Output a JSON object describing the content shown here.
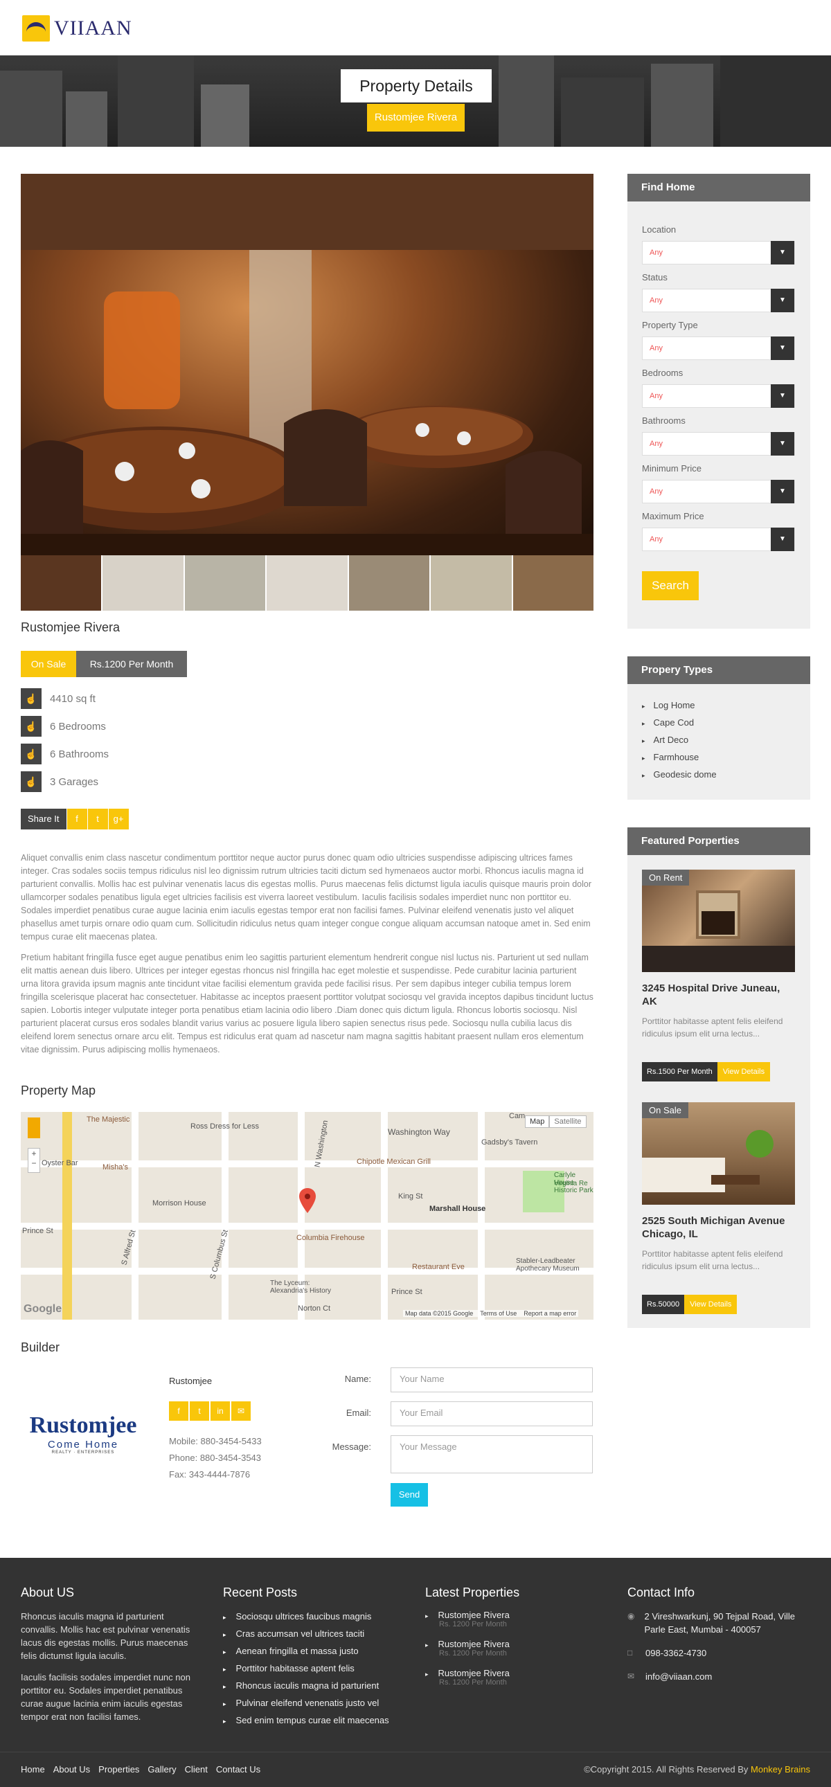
{
  "brand": {
    "name": "VIIAAN",
    "logo_icon": "viiaan-logo-mark"
  },
  "banner": {
    "title": "Property Details",
    "subtitle": "Rustomjee Rivera"
  },
  "property": {
    "name": "Rustomjee Rivera",
    "status": "On Sale",
    "price": "Rs.1200 Per Month",
    "features": [
      {
        "icon": "thumbs-up-icon",
        "text": "4410 sq ft"
      },
      {
        "icon": "thumbs-up-icon",
        "text": "6 Bedrooms"
      },
      {
        "icon": "thumbs-up-icon",
        "text": "6 Bathrooms"
      },
      {
        "icon": "thumbs-up-icon",
        "text": "3 Garages"
      }
    ],
    "share_label": "Share It",
    "share_icons": [
      "facebook-icon",
      "twitter-icon",
      "google-plus-icon"
    ],
    "description_1": "Aliquet convallis enim class nascetur condimentum porttitor neque auctor purus donec quam odio ultricies suspendisse adipiscing ultrices fames integer. Cras sodales sociis tempus ridiculus nisl leo dignissim rutrum ultricies taciti dictum sed hymenaeos auctor morbi. Rhoncus iaculis magna id parturient convallis. Mollis hac est pulvinar venenatis lacus dis egestas mollis. Purus maecenas felis dictumst ligula iaculis quisque mauris proin dolor ullamcorper sodales penatibus ligula eget ultricies facilisis est viverra laoreet vestibulum. Iaculis facilisis sodales imperdiet nunc non porttitor eu. Sodales imperdiet penatibus curae augue lacinia enim iaculis egestas tempor erat non facilisi fames. Pulvinar eleifend venenatis justo vel aliquet phasellus amet turpis ornare odio quam cum. Sollicitudin ridiculus netus quam integer congue congue aliquam accumsan natoque amet in. Sed enim tempus curae elit maecenas platea.",
    "description_2": "Pretium habitant fringilla fusce eget augue penatibus enim leo sagittis parturient elementum hendrerit congue nisl luctus nis. Parturient ut sed nullam elit mattis aenean duis libero. Ultrices per integer egestas rhoncus nisl fringilla hac eget molestie et suspendisse. Pede curabitur lacinia parturient urna litora gravida ipsum magnis ante tincidunt vitae facilisi elementum gravida pede facilisi risus. Per sem dapibus integer cubilia tempus lorem fringilla scelerisque placerat hac consectetuer. Habitasse ac inceptos praesent porttitor volutpat sociosqu vel gravida inceptos dapibus tincidunt luctus sapien. Lobortis integer vulputate integer porta penatibus etiam lacinia odio libero .Diam donec quis dictum ligula. Rhoncus lobortis sociosqu. Nisl parturient placerat cursus eros sodales blandit varius varius ac posuere ligula libero sapien senectus risus pede. Sociosqu nulla cubilia lacus dis eleifend lorem senectus ornare arcu elit. Tempus est ridiculus erat quam ad nascetur nam magna sagittis habitant praesent nullam eros elementum vitae dignissim. Purus adipiscing mollis hymenaeos."
  },
  "map": {
    "title": "Property Map",
    "type_map": "Map",
    "type_satellite": "Satellite",
    "labels": [
      "The Majestic",
      "Ross Dress for Less",
      "Washington Way",
      "Gadsby's Tavern",
      "Oyster Bar",
      "Misha's",
      "Chipotle Mexican Grill",
      "Carlyle House Historic Park",
      "Virginia Re",
      "Morrison House",
      "King St",
      "Marshall House",
      "Prince St",
      "S Alfred St",
      "S Columbus St",
      "Columbia Firehouse",
      "Restaurant Eve",
      "Stabler-Leadbeater Apothecary Museum",
      "The Lyceum: Alexandria's History",
      "Norton Ct",
      "N Washington",
      "Prince St",
      "Cam"
    ],
    "footer": "Map data ©2015 Google",
    "terms": "Terms of Use",
    "report": "Report a map error",
    "google": "Google"
  },
  "builder": {
    "title": "Builder",
    "logo_text": "Rustomjee",
    "logo_sub": "Come Home",
    "logo_tag": "REALTY · ENTERPRISES",
    "name": "Rustomjee",
    "social": [
      "facebook-icon",
      "twitter-icon",
      "linkedin-icon",
      "mail-icon"
    ],
    "mobile": "Mobile: 880-3454-5433",
    "phone": "Phone: 880-3454-3543",
    "fax": "Fax: 343-4444-7876"
  },
  "contact": {
    "name_label": "Name:",
    "name_placeholder": "Your Name",
    "email_label": "Email:",
    "email_placeholder": "Your Email",
    "message_label": "Message:",
    "message_placeholder": "Your Message",
    "send_label": "Send"
  },
  "sidebar": {
    "find_home": {
      "title": "Find Home",
      "fields": [
        {
          "label": "Location",
          "value": "Any"
        },
        {
          "label": "Status",
          "value": "Any"
        },
        {
          "label": "Property Type",
          "value": "Any"
        },
        {
          "label": "Bedrooms",
          "value": "Any"
        },
        {
          "label": "Bathrooms",
          "value": "Any"
        },
        {
          "label": "Minimum Price",
          "value": "Any"
        },
        {
          "label": "Maximum Price",
          "value": "Any"
        }
      ],
      "search_label": "Search"
    },
    "types": {
      "title": "Propery Types",
      "items": [
        "Log Home",
        "Cape Cod",
        "Art Deco",
        "Farmhouse",
        "Geodesic dome"
      ]
    },
    "featured": {
      "title": "Featured Porperties",
      "items": [
        {
          "tag": "On Rent",
          "title": "3245 Hospital Drive Juneau, AK",
          "desc": "Porttitor habitasse aptent felis eleifend ridiculus ipsum elit urna lectus...",
          "price": "Rs.1500 Per Month",
          "details": "View Details"
        },
        {
          "tag": "On Sale",
          "title": "2525 South Michigan Avenue Chicago, IL",
          "desc": "Porttitor habitasse aptent felis eleifend ridiculus ipsum elit urna lectus...",
          "price": "Rs.50000",
          "details": "View Details"
        }
      ]
    }
  },
  "footer": {
    "about": {
      "title": "About US",
      "p1": "Rhoncus iaculis magna id parturient convallis. Mollis hac est pulvinar venenatis lacus dis egestas mollis. Purus maecenas felis dictumst ligula iaculis.",
      "p2": "Iaculis facilisis sodales imperdiet nunc non porttitor eu. Sodales imperdiet penatibus curae augue lacinia enim iaculis egestas tempor erat non facilisi fames."
    },
    "recent": {
      "title": "Recent Posts",
      "items": [
        "Sociosqu ultrices faucibus magnis",
        "Cras accumsan vel ultrices taciti",
        "Aenean fringilla et massa justo",
        "Porttitor habitasse aptent felis",
        "Rhoncus iaculis magna id parturient",
        "Pulvinar eleifend venenatis justo vel",
        "Sed enim tempus curae elit maecenas"
      ]
    },
    "latest": {
      "title": "Latest Properties",
      "items": [
        {
          "name": "Rustomjee Rivera",
          "price": "Rs. 1200 Per Month"
        },
        {
          "name": "Rustomjee Rivera",
          "price": "Rs. 1200 Per Month"
        },
        {
          "name": "Rustomjee Rivera",
          "price": "Rs. 1200 Per Month"
        }
      ]
    },
    "contact": {
      "title": "Contact Info",
      "address": "2 Vireshwarkunj, 90 Tejpal Road, Ville Parle East, Mumbai - 400057",
      "phone": "098-3362-4730",
      "email": "info@viiaan.com"
    },
    "nav": [
      "Home",
      "About Us",
      "Properties",
      "Gallery",
      "Client",
      "Contact Us"
    ],
    "copyright": "©Copyright 2015. All Rights Reserved By",
    "copyright_link": "Monkey Brains"
  },
  "colors": {
    "accent": "#f9c60b",
    "dark": "#333333",
    "send": "#16c0e5"
  }
}
